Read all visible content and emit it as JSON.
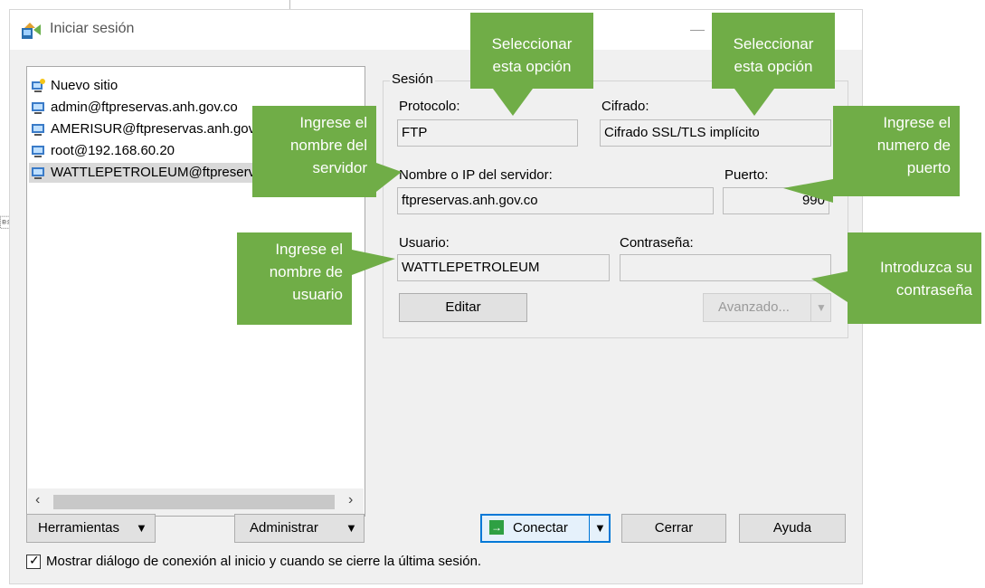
{
  "window": {
    "title": "Iniciar sesión"
  },
  "sites": [
    {
      "label": "Nuevo sitio",
      "icon": "new-site-icon",
      "selected": false
    },
    {
      "label": "admin@ftpreservas.anh.gov.co",
      "icon": "computer-icon",
      "selected": false
    },
    {
      "label": "AMERISUR@ftpreservas.anh.gov.co",
      "icon": "computer-icon",
      "selected": false
    },
    {
      "label": "root@192.168.60.20",
      "icon": "computer-icon",
      "selected": false
    },
    {
      "label": "WATTLEPETROLEUM@ftpreservas.anh.gov.co",
      "icon": "computer-icon",
      "selected": true
    }
  ],
  "session": {
    "group_label": "Sesión",
    "protocol_label": "Protocolo:",
    "protocol_value": "FTP",
    "encryption_label": "Cifrado:",
    "encryption_value": "Cifrado SSL/TLS implícito",
    "host_label": "Nombre o IP del servidor:",
    "host_value": "ftpreservas.anh.gov.co",
    "port_label": "Puerto:",
    "port_value": "990",
    "user_label": "Usuario:",
    "user_value": "WATTLEPETROLEUM",
    "password_label": "Contraseña:",
    "password_value": "",
    "edit_button": "Editar",
    "advanced_button": "Avanzado..."
  },
  "footer": {
    "tools_button": "Herramientas",
    "manage_button": "Administrar",
    "connect_button": "Conectar",
    "close_button": "Cerrar",
    "help_button": "Ayuda",
    "checkbox_label": "Mostrar diálogo de conexión al inicio y cuando se cierre la última sesión.",
    "checkbox_checked": true
  },
  "callouts": {
    "select_option_1": "Seleccionar\nesta opción",
    "select_option_2": "Seleccionar\nesta opción",
    "server_name": "Ingrese el\nnombre del\nservidor",
    "port_number": "Ingrese el\nnumero de\npuerto",
    "user_name": "Ingrese el\nnombre de\nusuario",
    "password": "Introduzca su\ncontraseña"
  },
  "colors": {
    "callout": "#70ad47",
    "accent": "#0078d7",
    "selection": "#d9d9d9"
  }
}
